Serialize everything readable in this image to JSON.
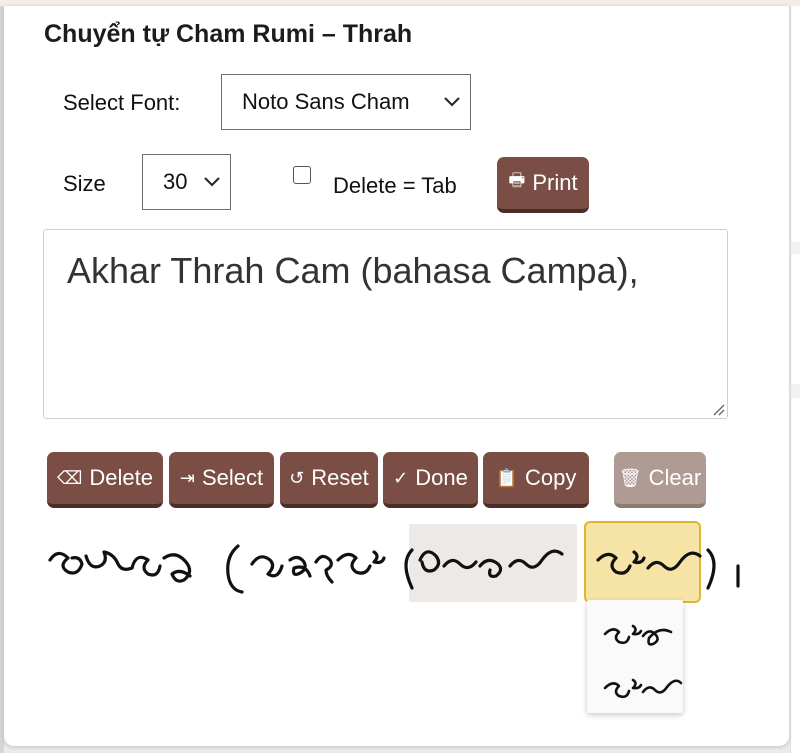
{
  "app": {
    "title": "Chuyển tự Cham Rumi – Thrah"
  },
  "controls": {
    "font_label": "Select Font:",
    "font_value": "Noto Sans Cham",
    "size_label": "Size",
    "size_value": "30",
    "delete_tab_label": "Delete = Tab",
    "delete_tab_checked": false,
    "print_label": "Print"
  },
  "editor": {
    "text": "Akhar Thrah Cam (bahasa Campa),"
  },
  "toolbar": {
    "delete_label": "Delete",
    "select_label": "Select",
    "reset_label": "Reset",
    "done_label": "Done",
    "copy_label": "Copy",
    "clear_label": "Clear"
  },
  "output": {
    "words": [
      "akhar",
      "thrah",
      "cam",
      "bahasa",
      "campa"
    ],
    "punctuation": [
      "(",
      ")",
      "."
    ],
    "suggestions_count": 2
  },
  "colors": {
    "button": "#7a4e44",
    "button_disabled": "#b09a94",
    "selected_highlight": "#f6e3a6",
    "selected_border": "#e0b531",
    "grey_highlight": "#ece9e6"
  },
  "icons": {
    "delete": "backspace-icon",
    "select": "tab-arrow-icon",
    "reset": "refresh-icon",
    "done": "check-icon",
    "copy": "clipboard-icon",
    "clear": "trash-icon",
    "print": "printer-icon",
    "chevron": "chevron-down-icon"
  }
}
